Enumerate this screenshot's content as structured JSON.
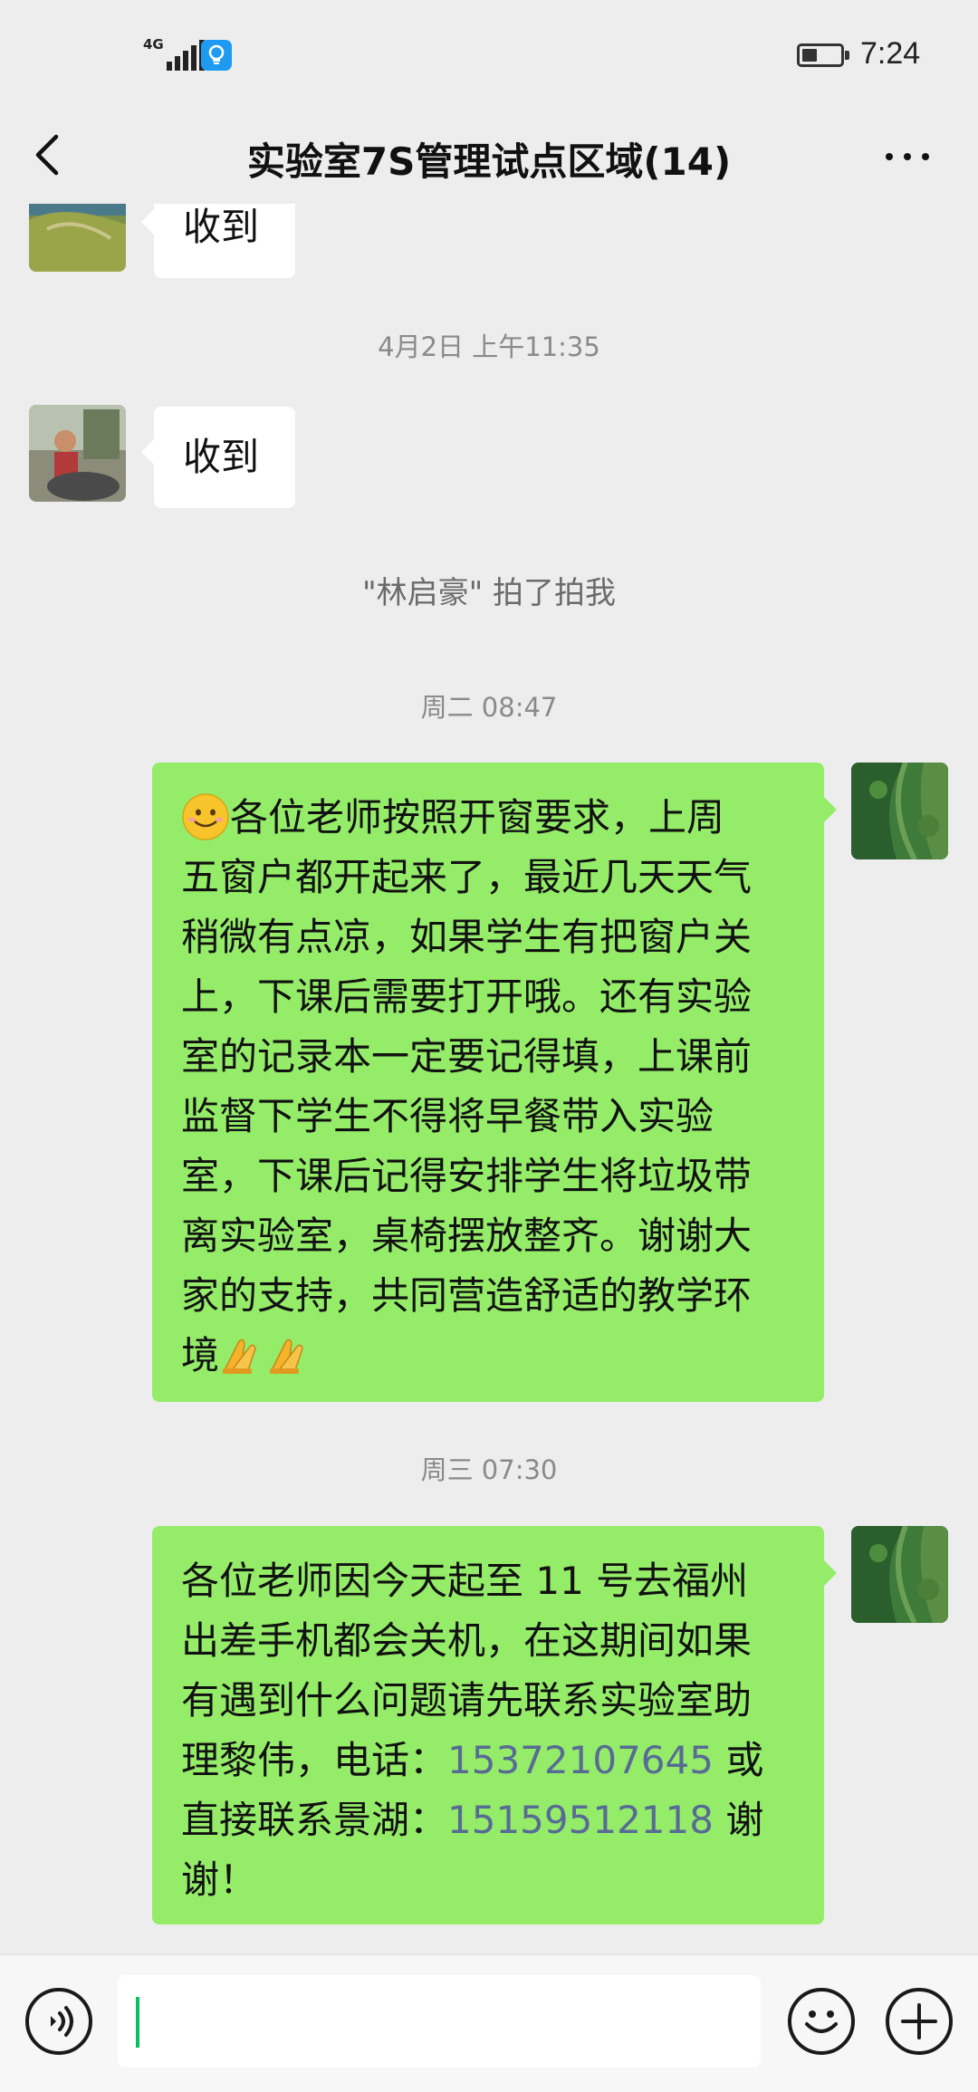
{
  "status_bar": {
    "network": "4G",
    "time": "7:24"
  },
  "header": {
    "title": "实验室7S管理试点区域(14)"
  },
  "messages": [
    {
      "id": "m1",
      "type": "incoming",
      "text": "收到"
    },
    {
      "id": "ts1",
      "type": "timestamp",
      "text": "4月2日 上午11:35"
    },
    {
      "id": "m2",
      "type": "incoming",
      "text": "收到"
    },
    {
      "id": "sys1",
      "type": "system",
      "text": "\"林启豪\" 拍了拍我"
    },
    {
      "id": "ts2",
      "type": "timestamp",
      "text": "周二 08:47"
    },
    {
      "id": "m3",
      "type": "outgoing",
      "lines": [
        "各位老师按照开窗要求，上周",
        "五窗户都开起来了，最近几天天气",
        "稍微有点凉，如果学生有把窗户关",
        "上，下课后需要打开哦。还有实验",
        "室的记录本一定要记得填，上课前",
        "监督下学生不得将早餐带入实验",
        "室，下课后记得安排学生将垃圾带",
        "离实验室，桌椅摆放整齐。谢谢大",
        "家的支持，共同营造舒适的教学环",
        "境"
      ]
    },
    {
      "id": "ts3",
      "type": "timestamp",
      "text": "周三 07:30"
    },
    {
      "id": "m4",
      "type": "outgoing",
      "line1": "各位老师因今天起至 11 号去福州",
      "line2": "出差手机都会关机，在这期间如果",
      "line3": "有遇到什么问题请先联系实验室助",
      "line4_pre": "理黎伟，电话：",
      "phone1": "15372107645",
      "line4_post": " 或",
      "line5_pre": "直接联系景湖：",
      "phone2": "15159512118",
      "line5_post": " 谢",
      "line6": "谢！"
    }
  ],
  "input_bar": {
    "voice_icon": "voice-icon",
    "emoji_icon": "emoji-icon",
    "plus_icon": "plus-icon",
    "value": ""
  },
  "colors": {
    "outgoing_bubble": "#95ec69",
    "incoming_bubble": "#ffffff",
    "background": "#ededed",
    "phone_link": "#576b95"
  }
}
